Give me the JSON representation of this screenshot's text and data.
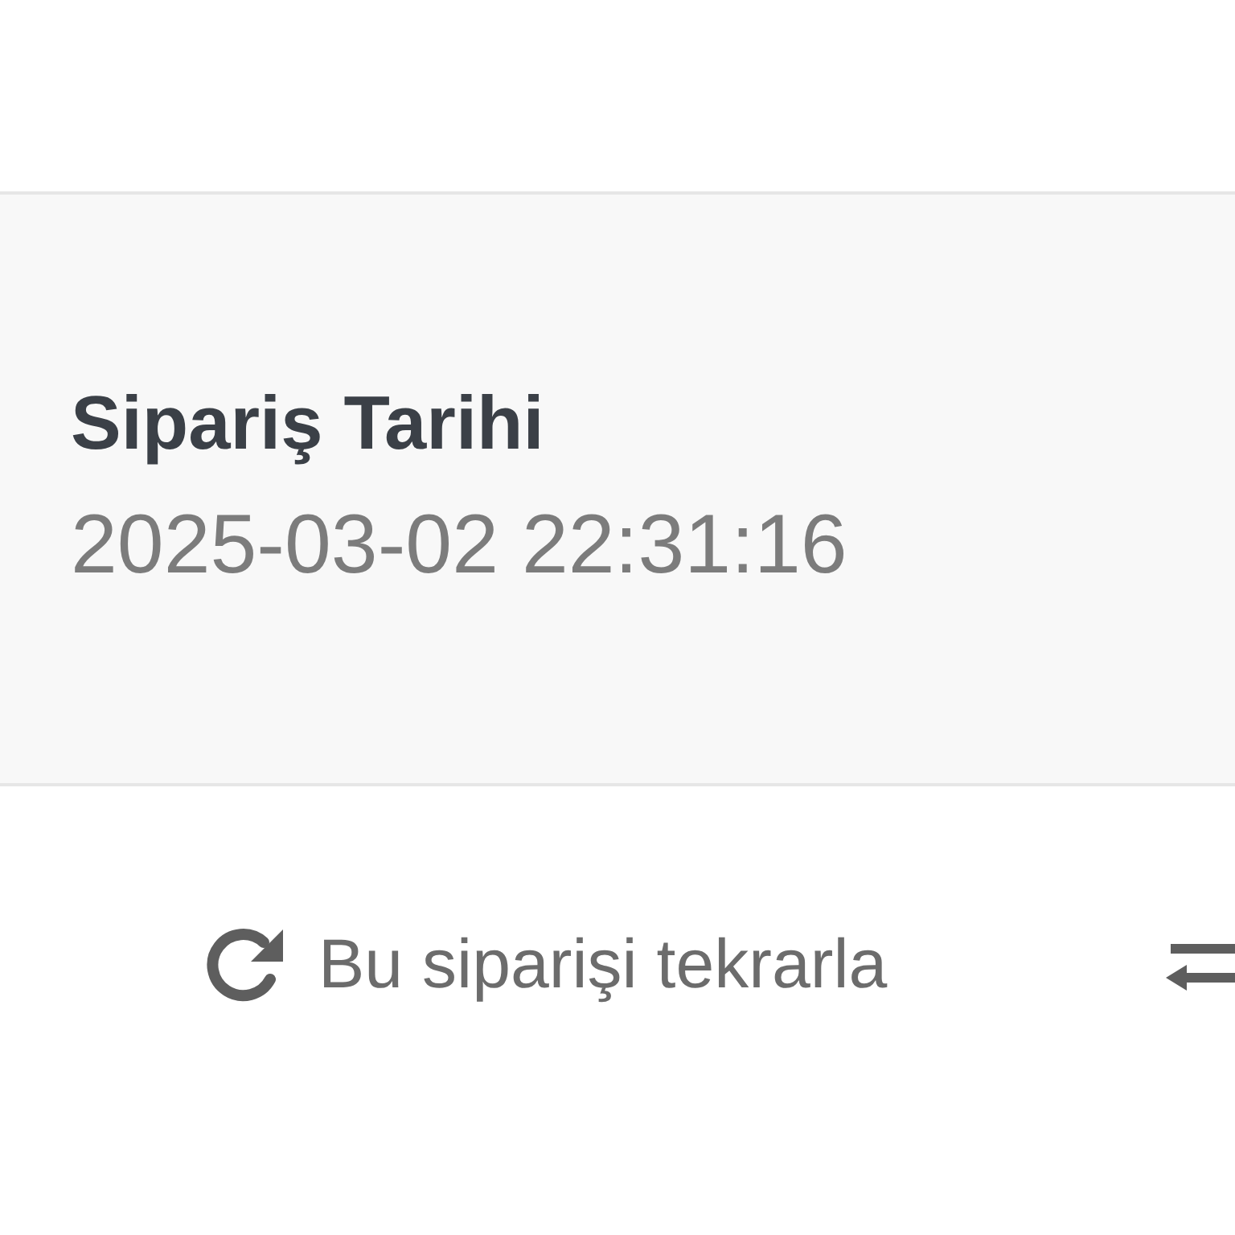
{
  "order_date": {
    "label": "Sipariş Tarihi",
    "value": "2025-03-02 22:31:16"
  },
  "actions": [
    {
      "kind": "reorder",
      "label": "Bu siparişi tekrarla"
    },
    {
      "kind": "swap"
    }
  ]
}
